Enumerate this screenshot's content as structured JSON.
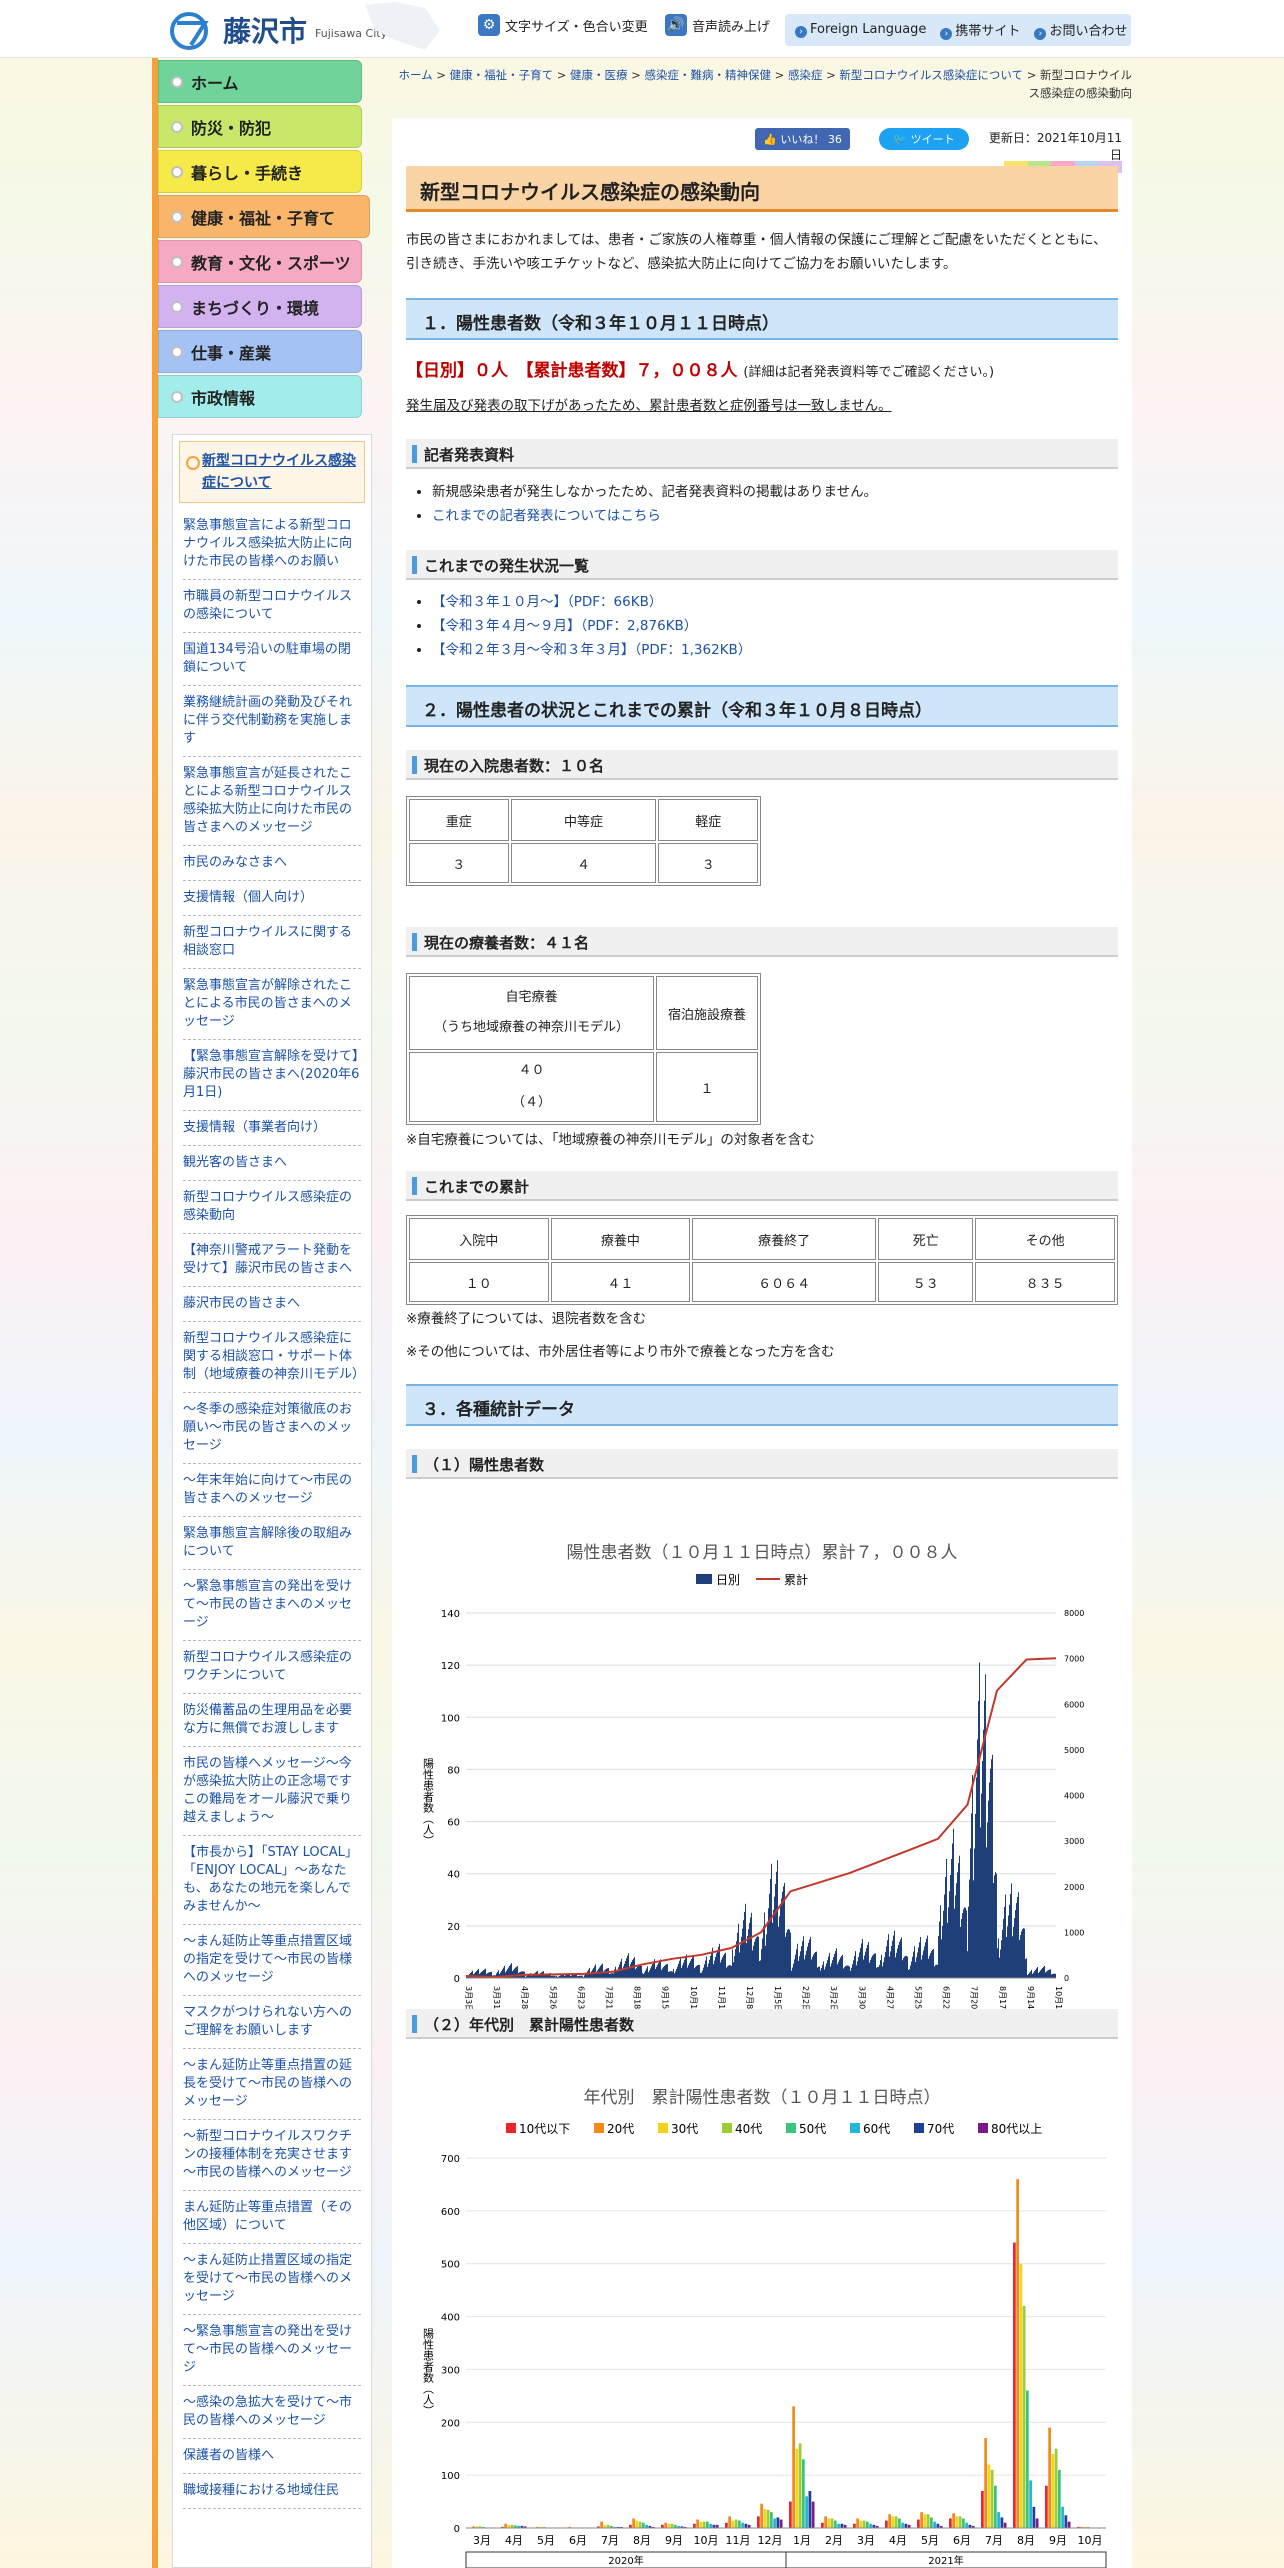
{
  "header": {
    "city": "藤沢市",
    "city_en": "Fujisawa City",
    "font_size_label": "文字サイズ・色合い変更",
    "voice_label": "音声読み上げ",
    "foreign_label": "Foreign Language",
    "mobile_label": "携帯サイト",
    "contact_label": "お問い合わせ"
  },
  "nav": [
    {
      "label": "ホーム",
      "color": "#6fd39a"
    },
    {
      "label": "防災・防犯",
      "color": "#c9e86a"
    },
    {
      "label": "暮らし・手続き",
      "color": "#f6ea4a"
    },
    {
      "label": "健康・福祉・子育て",
      "color": "#f9b66a"
    },
    {
      "label": "教育・文化・スポーツ",
      "color": "#f6a9c2"
    },
    {
      "label": "まちづくり・環境",
      "color": "#d2b3f0"
    },
    {
      "label": "仕事・産業",
      "color": "#a4c3f4"
    },
    {
      "label": "市政情報",
      "color": "#a3ecec"
    }
  ],
  "sub_title": "新型コロナウイルス感染症について",
  "sub_links": [
    "緊急事態宣言による新型コロナウイルス感染拡大防止に向けた市民の皆様へのお願い",
    "市職員の新型コロナウイルスの感染について",
    "国道134号沿いの駐車場の閉鎖について",
    "業務継続計画の発動及びそれに伴う交代制勤務を実施します",
    "緊急事態宣言が延長されたことによる新型コロナウイルス感染拡大防止に向けた市民の皆さまへのメッセージ",
    "市民のみなさまへ",
    "支援情報（個人向け）",
    "新型コロナウイルスに関する相談窓口",
    "緊急事態宣言が解除されたことによる市民の皆さまへのメッセージ",
    "【緊急事態宣言解除を受けて】藤沢市民の皆さまへ(2020年6月1日)",
    "支援情報（事業者向け）",
    "観光客の皆さまへ",
    "新型コロナウイルス感染症の感染動向",
    "【神奈川警戒アラート発動を受けて】藤沢市民の皆さまへ",
    "藤沢市民の皆さまへ",
    "新型コロナウイルス感染症に関する相談窓口・サポート体制（地域療養の神奈川モデル）",
    "～冬季の感染症対策徹底のお願い～市民の皆さまへのメッセージ",
    "～年末年始に向けて～市民の皆さまへのメッセージ",
    "緊急事態宣言解除後の取組みについて",
    "～緊急事態宣言の発出を受けて～市民の皆さまへのメッセージ",
    "新型コロナウイルス感染症のワクチンについて",
    "防災備蓄品の生理用品を必要な方に無償でお渡しします",
    "市民の皆様へメッセージ～今が感染拡大防止の正念場です この難局をオール藤沢で乗り越えましょう～",
    "【市長から】「STAY LOCAL」「ENJOY LOCAL」～あなたも、あなたの地元を楽しんでみませんか～",
    "～まん延防止等重点措置区域の指定を受けて～市民の皆様へのメッセージ",
    "マスクがつけられない方へのご理解をお願いします",
    "～まん延防止等重点措置の延長を受けて～市民の皆様へのメッセージ",
    "～新型コロナウイルスワクチンの接種体制を充実させます～市民の皆様へのメッセージ",
    "まん延防止等重点措置（その他区域）について",
    "～まん延防止措置区域の指定を受けて～市民の皆様へのメッセージ",
    "～緊急事態宣言の発出を受けて～市民の皆様へのメッセージ",
    "～感染の急拡大を受けて～市民の皆様へのメッセージ",
    "保護者の皆様へ",
    "職域接種における地域住民"
  ],
  "breadcrumb": [
    "ホーム",
    "健康・福祉・子育て",
    "健康・医療",
    "感染症・難病・精神保健",
    "感染症",
    "新型コロナウイルス感染症について",
    "新型コロナウイルス感染症の感染動向"
  ],
  "social": {
    "like": "いいね！ 36",
    "tweet": "ツイート"
  },
  "updated": "更新日：2021年10月11日",
  "page_title": "新型コロナウイルス感染症の感染動向",
  "intro": "市民の皆さまにおかれましては、患者・ご家族の人権尊重・個人情報の保護にご理解とご配慮をいただくとともに、引き続き、手洗いや咳エチケットなど、感染拡大防止に向けてご協力をお願いいたします。",
  "s1": {
    "title": "１．陽性患者数（令和３年１０月１１日時点）",
    "daily": "【日別】０人　【累計患者数】７，００８人",
    "detail": "(詳細は記者発表資料等でご確認ください。)",
    "note": "発生届及び発表の取下げがあったため、累計患者数と症例番号は一致しません。"
  },
  "press": {
    "title": "記者発表資料",
    "items": [
      "新規感染患者が発生しなかったため、記者発表資料の掲載はありません。",
      "これまでの記者発表についてはこちら"
    ]
  },
  "history": {
    "title": "これまでの発生状況一覧",
    "items": [
      "【令和３年１０月～】（PDF：66KB）",
      "【令和３年４月～９月】（PDF：2,876KB）",
      "【令和２年３月～令和３年３月】（PDF：1,362KB）"
    ]
  },
  "s2": {
    "title": "２．陽性患者の状況とこれまでの累計（令和３年１０月８日時点）"
  },
  "inpatient": {
    "title": "現在の入院患者数：１０名",
    "headers": [
      "重症",
      "中等症",
      "軽症"
    ],
    "values": [
      "３",
      "４",
      "３"
    ]
  },
  "recuperation": {
    "title": "現在の療養者数：４１名",
    "h1a": "自宅療養",
    "h1b": "（うち地域療養の神奈川モデル）",
    "h2": "宿泊施設療養",
    "v1a": "４０",
    "v1b": "（４）",
    "v2": "１",
    "note": "※自宅療養については、「地域療養の神奈川モデル」の対象者を含む"
  },
  "cumulative": {
    "title": "これまでの累計",
    "headers": [
      "入院中",
      "療養中",
      "療養終了",
      "死亡",
      "その他"
    ],
    "values": [
      "１０",
      "４１",
      "６０６４",
      "５３",
      "８３５"
    ],
    "note1": "※療養終了については、退院者数を含む",
    "note2": "※その他については、市外居住者等により市外で療養となった方を含む"
  },
  "s3": {
    "title": "３．各種統計データ",
    "sub1": "（１）陽性患者数",
    "sub2": "（２）年代別　累計陽性患者数"
  },
  "chart_data": [
    {
      "type": "bar",
      "title": "陽性患者数（１０月１１日時点）累計７，００８人",
      "series": [
        {
          "name": "日別",
          "color": "#1f3f7a"
        },
        {
          "name": "累計",
          "color": "#c0392b"
        }
      ],
      "ylabel": "陽性患者数（人）",
      "ylim": [
        0,
        140
      ],
      "y2lim": [
        0,
        8000
      ],
      "yticks": [
        0,
        20,
        40,
        60,
        80,
        100,
        120,
        140
      ],
      "y2ticks": [
        0,
        1000,
        2000,
        3000,
        4000,
        5000,
        6000,
        7000,
        8000
      ],
      "x_ticks": [
        "3月3日",
        "3月31日",
        "4月28日",
        "5月26日",
        "6月23日",
        "7月21日",
        "8月18日",
        "9月15日",
        "10月13日",
        "11月10日",
        "12月8日",
        "1月5日",
        "2月2日",
        "3月2日",
        "3月30日",
        "4月27日",
        "5月25日",
        "6月22日",
        "7月20日",
        "8月17日",
        "9月14日",
        "10月12日"
      ],
      "monthly_daily_peak": [
        [
          "3月",
          4
        ],
        [
          "4月",
          6
        ],
        [
          "5月",
          3
        ],
        [
          "6月",
          2
        ],
        [
          "7月",
          6
        ],
        [
          "8月",
          10
        ],
        [
          "9月",
          8
        ],
        [
          "10月",
          10
        ],
        [
          "11月",
          14
        ],
        [
          "12月",
          30
        ],
        [
          "1月",
          50
        ],
        [
          "2月",
          18
        ],
        [
          "3月",
          12
        ],
        [
          "4月",
          16
        ],
        [
          "5月",
          20
        ],
        [
          "6月",
          18
        ],
        [
          "7月",
          60
        ],
        [
          "8月",
          132
        ],
        [
          "9月",
          40
        ],
        [
          "10月",
          5
        ]
      ],
      "cumulative_by_month_end": [
        [
          "3月",
          20
        ],
        [
          "4月",
          70
        ],
        [
          "5月",
          80
        ],
        [
          "6月",
          90
        ],
        [
          "7月",
          140
        ],
        [
          "8月",
          300
        ],
        [
          "9月",
          420
        ],
        [
          "10月",
          510
        ],
        [
          "11月",
          660
        ],
        [
          "12月",
          1000
        ],
        [
          "1月",
          1900
        ],
        [
          "2月",
          2100
        ],
        [
          "3月",
          2300
        ],
        [
          "4月",
          2550
        ],
        [
          "5月",
          2800
        ],
        [
          "6月",
          3050
        ],
        [
          "7月",
          3800
        ],
        [
          "8月",
          6300
        ],
        [
          "9月",
          6980
        ],
        [
          "10月",
          7008
        ]
      ]
    },
    {
      "type": "bar",
      "title": "年代別　累計陽性患者数（１０月１１日時点）",
      "ylabel": "陽性患者数（人）",
      "ylim": [
        0,
        700
      ],
      "yticks": [
        0,
        100,
        200,
        300,
        400,
        500,
        600,
        700
      ],
      "categories": [
        "3月",
        "4月",
        "5月",
        "6月",
        "7月",
        "8月",
        "9月",
        "10月",
        "11月",
        "12月",
        "1月",
        "2月",
        "3月",
        "4月",
        "5月",
        "6月",
        "7月",
        "8月",
        "9月",
        "10月"
      ],
      "year_groups": [
        {
          "label": "2020年",
          "span": 10
        },
        {
          "label": "2021年",
          "span": 10
        }
      ],
      "series": [
        {
          "name": "10代以下",
          "color": "#e8262b",
          "values": [
            1,
            2,
            1,
            1,
            3,
            6,
            6,
            8,
            10,
            22,
            50,
            10,
            8,
            14,
            16,
            18,
            70,
            540,
            80,
            2
          ]
        },
        {
          "name": "20代",
          "color": "#f08a1c",
          "values": [
            3,
            8,
            2,
            2,
            12,
            18,
            10,
            16,
            22,
            46,
            230,
            22,
            18,
            26,
            30,
            28,
            170,
            660,
            190,
            2
          ]
        },
        {
          "name": "30代",
          "color": "#f2d21b",
          "values": [
            3,
            6,
            2,
            1,
            6,
            14,
            8,
            12,
            14,
            36,
            150,
            18,
            14,
            22,
            26,
            22,
            120,
            500,
            140,
            2
          ]
        },
        {
          "name": "40代",
          "color": "#9acd32",
          "values": [
            3,
            6,
            2,
            1,
            6,
            12,
            8,
            12,
            16,
            34,
            160,
            18,
            14,
            22,
            26,
            22,
            110,
            420,
            150,
            2
          ]
        },
        {
          "name": "50代",
          "color": "#3cc47a",
          "values": [
            2,
            5,
            1,
            1,
            4,
            10,
            6,
            12,
            14,
            30,
            130,
            14,
            12,
            18,
            20,
            18,
            80,
            260,
            110,
            1
          ]
        },
        {
          "name": "60代",
          "color": "#26b6d6",
          "values": [
            1,
            4,
            1,
            1,
            2,
            6,
            4,
            8,
            10,
            18,
            60,
            8,
            8,
            10,
            12,
            10,
            30,
            90,
            40,
            1
          ]
        },
        {
          "name": "70代",
          "color": "#1f3f9a",
          "values": [
            1,
            4,
            1,
            1,
            2,
            4,
            3,
            6,
            8,
            20,
            70,
            8,
            6,
            8,
            8,
            6,
            20,
            40,
            24,
            1
          ]
        },
        {
          "name": "80代以上",
          "color": "#7a1a8a",
          "values": [
            1,
            3,
            1,
            1,
            2,
            2,
            2,
            6,
            6,
            16,
            50,
            6,
            4,
            6,
            4,
            4,
            10,
            18,
            12,
            1
          ]
        }
      ]
    }
  ]
}
